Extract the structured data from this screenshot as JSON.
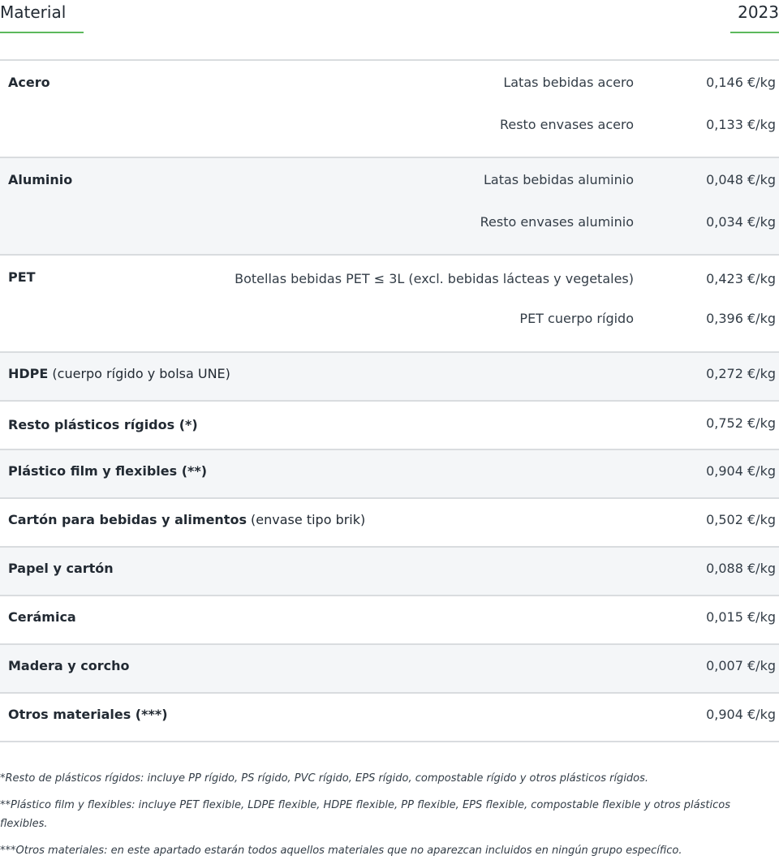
{
  "header": {
    "material_label": "Material",
    "year_label": "2023"
  },
  "rows": [
    {
      "material": "Acero",
      "extra": "",
      "items": [
        {
          "name": "Latas bebidas acero",
          "price": "0,146 €/kg"
        },
        {
          "name": "Resto envases acero",
          "price": "0,133 €/kg"
        }
      ]
    },
    {
      "material": "Aluminio",
      "extra": "",
      "items": [
        {
          "name": "Latas bebidas aluminio",
          "price": "0,048 €/kg"
        },
        {
          "name": "Resto envases aluminio",
          "price": "0,034 €/kg"
        }
      ]
    },
    {
      "material": "PET",
      "extra": "",
      "items": [
        {
          "name": "Botellas bebidas PET ≤ 3L (excl. bebidas lácteas y vegetales)",
          "price": "0,423 €/kg"
        },
        {
          "name": "PET cuerpo rígido",
          "price": "0,396 €/kg"
        }
      ]
    },
    {
      "material": "HDPE",
      "extra": " (cuerpo rígido y bolsa UNE)",
      "price": "0,272 €/kg"
    },
    {
      "material": "Resto plásticos rígidos (*)",
      "extra": "",
      "price": "0,752 €/kg"
    },
    {
      "material": "Plástico film y flexibles (**)",
      "extra": "",
      "price": "0,904 €/kg"
    },
    {
      "material": "Cartón para bebidas y alimentos",
      "extra": " (envase tipo brik)",
      "price": "0,502 €/kg"
    },
    {
      "material": "Papel y cartón",
      "extra": "",
      "price": "0,088 €/kg"
    },
    {
      "material": "Cerámica",
      "extra": "",
      "price": "0,015 €/kg"
    },
    {
      "material": "Madera y corcho",
      "extra": "",
      "price": "0,007 €/kg"
    },
    {
      "material": "Otros materiales (***)",
      "extra": "",
      "price": "0,904 €/kg"
    }
  ],
  "notes": [
    "*Resto de plásticos rígidos: incluye PP rígido, PS rígido, PVC rígido, EPS rígido, compostable rígido y otros plásticos rígidos.",
    "**Plástico film y flexibles: incluye PET flexible, LDPE flexible, HDPE flexible, PP flexible, EPS flexible, compostable flexible y otros plásticos flexibles.",
    "***Otros materiales: en este apartado estarán todos aquellos materiales que no aparezcan incluidos en ningún grupo específico."
  ]
}
